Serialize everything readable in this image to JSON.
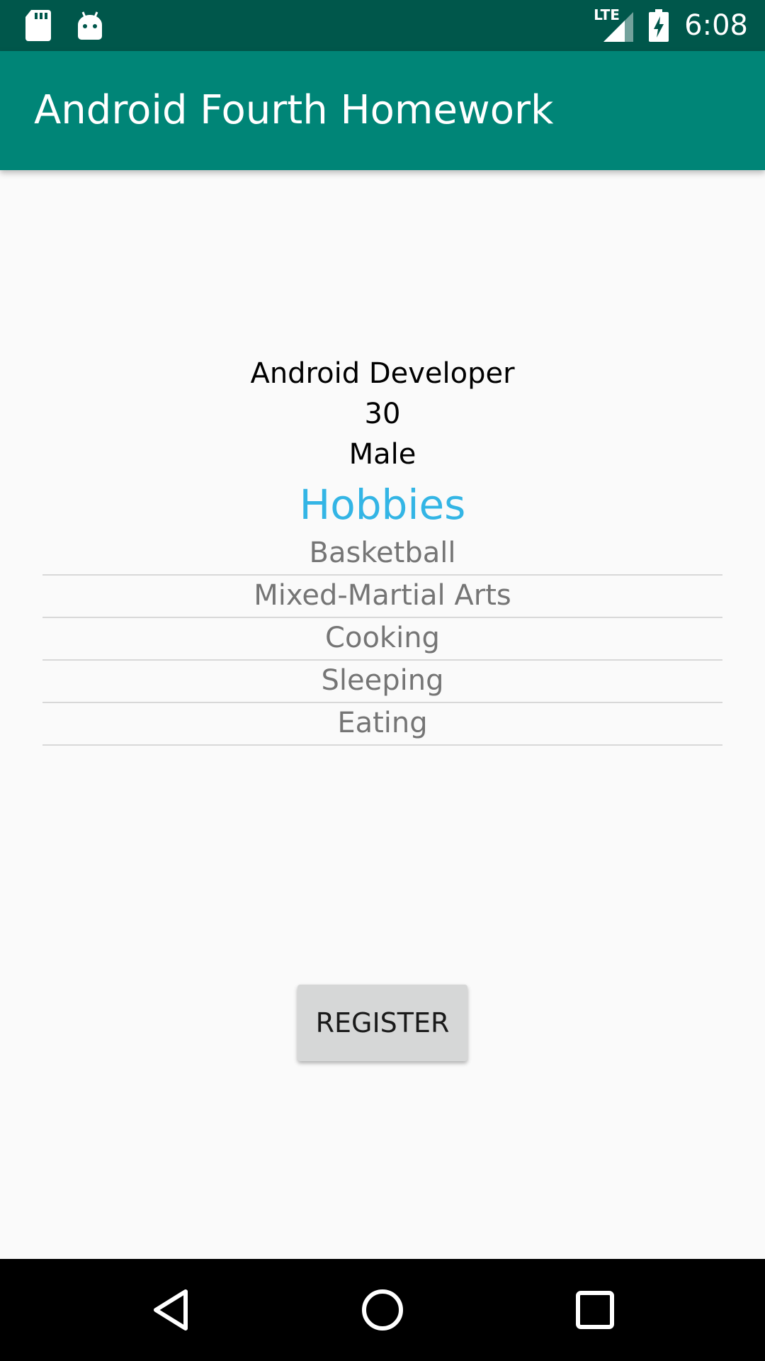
{
  "status_bar": {
    "time": "6:08",
    "network": "LTE",
    "icons": [
      "sd-card-icon",
      "android-icon",
      "lte-signal-icon",
      "battery-charging-icon"
    ]
  },
  "app_bar": {
    "title": "Android Fourth Homework"
  },
  "profile": {
    "occupation": "Android Developer",
    "age": "30",
    "gender": "Male"
  },
  "hobbies": {
    "title": "Hobbies",
    "items": [
      "Basketball",
      "Mixed-Martial Arts",
      "Cooking",
      "Sleeping",
      "Eating"
    ]
  },
  "register_label": "REGISTER",
  "nav_bar": {
    "icons": [
      "back-icon",
      "home-icon",
      "recents-icon"
    ]
  },
  "colors": {
    "status_bar": "#00574b",
    "app_bar": "#008577",
    "accent": "#33b5e5",
    "button": "#d6d7d7"
  }
}
